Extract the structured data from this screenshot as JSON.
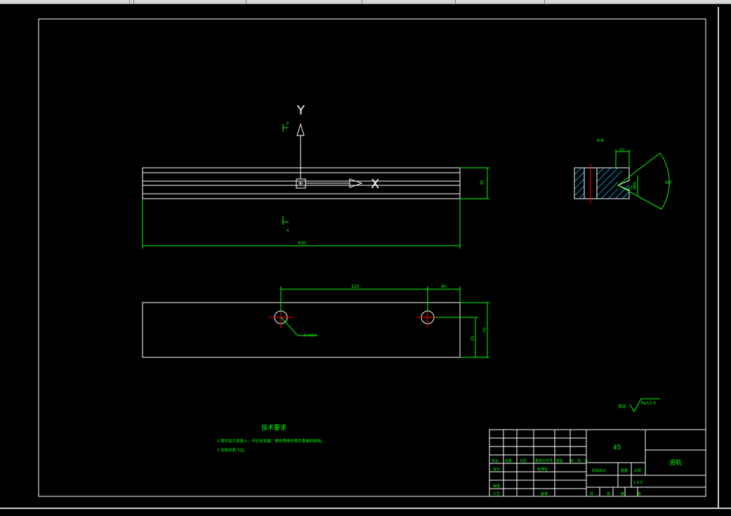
{
  "colors": {
    "background": "#000000",
    "outline": "#ffffff",
    "dimension": "#00ff00",
    "center_mark": "#ff0000",
    "hatch": "#00c8ff"
  },
  "ucs": {
    "y_label": "Y",
    "x_label": "X"
  },
  "top_view": {
    "height_dim": "30",
    "length_dim": "400",
    "section_mark_top": "A",
    "section_mark_bottom": "A"
  },
  "section_view": {
    "title": "A-A",
    "width_dim": "10",
    "depth_dim": "R4.2",
    "chamfer_dim": "20.5",
    "angle_dim": "60°"
  },
  "front_view": {
    "spacing_dim": "220",
    "offset_dim": "40",
    "total_height_dim": "70",
    "half_height_dim": "35",
    "hole_callout": "2×φ10"
  },
  "roughness": {
    "label": "其余",
    "value": "Ra12.5"
  },
  "tech_req": {
    "title": "技术要求",
    "items": [
      "1.零件加工表面上，不应有划痕、擦伤等损伤零件表面的缺陷。",
      "2.去除毛刺飞边。"
    ]
  },
  "title_block": {
    "material": "45",
    "part_name": "滑轨",
    "rev_headers": [
      "标记",
      "处数",
      "分区",
      "更改文件号",
      "签名",
      "年、月、日"
    ],
    "roles": [
      "设计",
      "审核",
      "工艺"
    ],
    "standardize": "标准化",
    "approve": "批准",
    "stage_label": "阶段标记",
    "weight_label": "重量",
    "scale_label": "比例",
    "scale_value": "1:4.9",
    "sheet_labels": [
      "共",
      "张",
      "第",
      "张"
    ]
  }
}
